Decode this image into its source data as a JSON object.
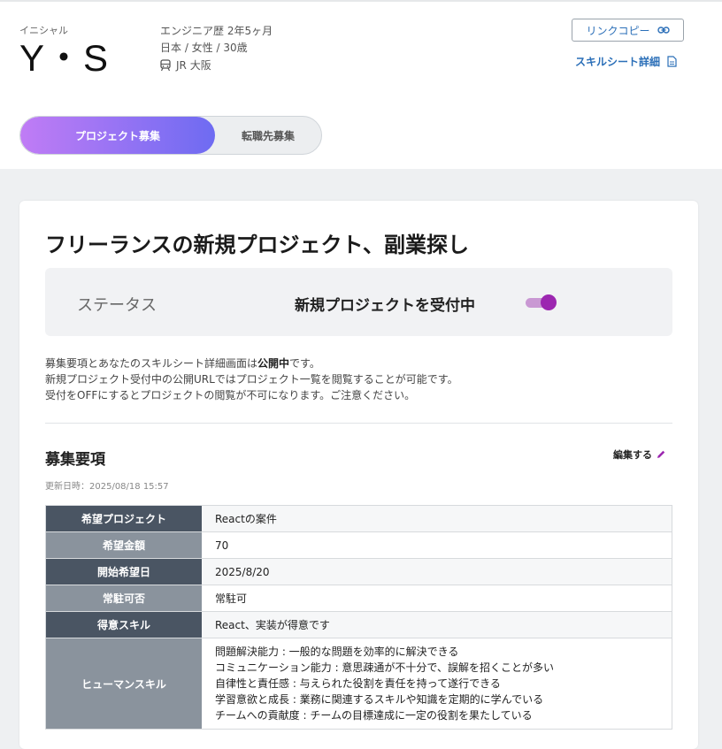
{
  "profile": {
    "initial_label": "イニシャル",
    "initials": "Y・S",
    "experience": "エンジニア歴 2年5ヶ月",
    "demographics": "日本 / 女性 / 30歳",
    "station": "JR 大阪"
  },
  "actions": {
    "link_copy": "リンクコピー",
    "skill_sheet": "スキルシート詳細"
  },
  "tabs": {
    "project": "プロジェクト募集",
    "job_change": "転職先募集"
  },
  "card": {
    "title": "フリーランスの新規プロジェクト、副業探し",
    "status_label": "ステータス",
    "status_value": "新規プロジェクトを受付中",
    "toggle_on": true,
    "notice": {
      "line1_prefix": "募集要項とあなたのスキルシート詳細画面は",
      "line1_bold": "公開中",
      "line1_suffix": "です。",
      "line2": "新規プロジェクト受付中の公開URLではプロジェクト一覧を閲覧することが可能です。",
      "line3": "受付をOFFにするとプロジェクトの閲覧が不可になります。ご注意ください。"
    }
  },
  "requirements": {
    "title": "募集要項",
    "edit": "編集する",
    "updated": "更新日時：2025/08/18 15:57",
    "rows": [
      {
        "label": "希望プロジェクト",
        "value": "Reactの案件"
      },
      {
        "label": "希望金額",
        "value": "70"
      },
      {
        "label": "開始希望日",
        "value": "2025/8/20"
      },
      {
        "label": "常駐可否",
        "value": "常駐可"
      },
      {
        "label": "得意スキル",
        "value": "React、実装が得意です"
      }
    ],
    "human_skill_label": "ヒューマンスキル",
    "human_skills": [
      "問題解決能力 : 一般的な問題を効率的に解決できる",
      "コミュニケーション能力 : 意思疎通が不十分で、誤解を招くことが多い",
      "自律性と責任感 : 与えられた役割を責任を持って遂行できる",
      "学習意欲と成長 : 業務に関連するスキルや知識を定期的に学んでいる",
      "チームへの貢献度 : チームの目標達成に一定の役割を果たしている"
    ]
  },
  "colors": {
    "accent_start": "#c07cf5",
    "accent_end": "#6e6bf2",
    "toggle": "#9c27b0",
    "link": "#2b6fb8",
    "table_header_dark": "#4a5563",
    "table_header_light": "#8a939d"
  }
}
